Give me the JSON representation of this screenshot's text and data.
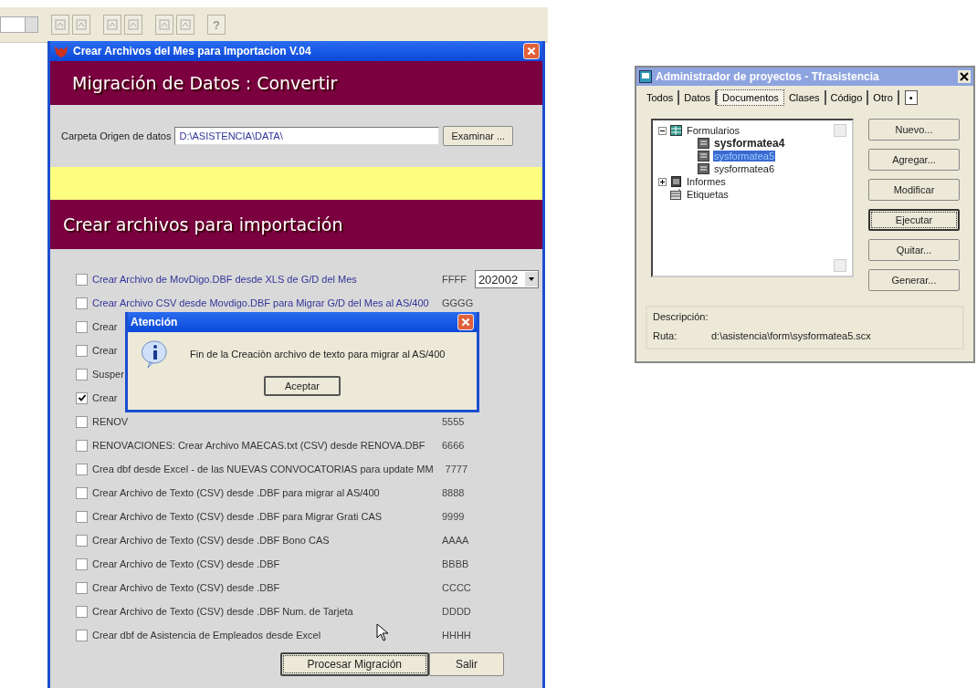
{
  "toolbar": {
    "help_label": "?"
  },
  "main_window": {
    "title": "Crear Archivos del Mes para Importacion  V.04",
    "header": "Migración de Datos : Convertir",
    "folder_label": "Carpeta Origen de datos",
    "folder_value": "D:\\ASISTENCIA\\DATA\\",
    "browse_button": "Examinar ...",
    "section_title": "Crear archivos para importación",
    "options": [
      {
        "label": "Crear Archivo de  MovDigo.DBF desde XLS de G/D  del Mes",
        "code": "FFFF",
        "checked": false,
        "color": "#33339a",
        "dropdown": "202002"
      },
      {
        "label": "Crear Archivo CSV desde  Movdigo.DBF para Migrar G/D del Mes al AS/400",
        "code": "GGGG",
        "checked": false,
        "color": "#33339a"
      },
      {
        "label": "Crear",
        "checked": false,
        "color": "#333333"
      },
      {
        "label": "Crear",
        "checked": false,
        "color": "#333333"
      },
      {
        "label": "Susper",
        "checked": false,
        "color": "#333333"
      },
      {
        "label": "Crear",
        "checked": true,
        "color": "#333333"
      },
      {
        "label": "RENOV",
        "code": "5555",
        "checked": false,
        "color": "#333333"
      },
      {
        "label": "RENOVACIONES: Crear Archivo MAECAS.txt (CSV) desde  RENOVA.DBF",
        "code": "6666",
        "checked": false,
        "color": "#333333"
      },
      {
        "label": "Crea dbf desde Excel - de las NUEVAS CONVOCATORIAS para update MM",
        "code": "7777",
        "checked": false,
        "color": "#333333"
      },
      {
        "label": "Crear Archivo de Texto (CSV) desde  .DBF  para migrar al AS/400",
        "code": "8888",
        "checked": false,
        "color": "#333333"
      },
      {
        "label": "Crear Archivo de Texto (CSV) desde  .DBF  para Migrar Grati CAS",
        "code": "9999",
        "checked": false,
        "color": "#333333"
      },
      {
        "label": "Crear Archivo de Texto (CSV) desde  .DBF  Bono CAS",
        "code": "AAAA",
        "checked": false,
        "color": "#333333"
      },
      {
        "label": "Crear Archivo de Texto (CSV) desde  .DBF",
        "code": "BBBB",
        "checked": false,
        "color": "#333333"
      },
      {
        "label": "Crear Archivo de Texto (CSV) desde  .DBF",
        "code": "CCCC",
        "checked": false,
        "color": "#333333"
      },
      {
        "label": "Crear Archivo de Texto (CSV) desde  .DBF Num. de Tarjeta",
        "code": "DDDD",
        "checked": false,
        "color": "#333333"
      },
      {
        "label": "Crear  dbf de Asistencia  de Empleados desde  Excel",
        "code": "HHHH",
        "checked": false,
        "color": "#333333"
      }
    ],
    "buttons": [
      {
        "label": "Procesar Migración",
        "focused": true
      },
      {
        "label": "Salir",
        "focused": false
      }
    ]
  },
  "dialog": {
    "title": "Atención",
    "message": "Fin de la Creaciòn archivo de texto para migrar al AS/400",
    "button": "Aceptar"
  },
  "project_manager": {
    "title": "Administrador de proyectos - Tfrasistencia",
    "tabs": [
      {
        "label": "Todos",
        "selected": false
      },
      {
        "label": "Datos",
        "selected": false
      },
      {
        "label": "Documentos",
        "selected": true
      },
      {
        "label": "Clases",
        "selected": false
      },
      {
        "label": "Código",
        "selected": false
      },
      {
        "label": "Otro",
        "selected": false
      }
    ],
    "tab_more": "•",
    "tree": [
      {
        "label": "Formularios",
        "expanded": true,
        "kind": "forms",
        "children": [
          {
            "label": "sysformatea4",
            "bold": true,
            "selected": false,
            "kind": "form"
          },
          {
            "label": "sysformatea5",
            "bold": false,
            "selected": true,
            "kind": "form"
          },
          {
            "label": "sysformatea6",
            "bold": false,
            "selected": false,
            "kind": "form"
          }
        ]
      },
      {
        "label": "Informes",
        "expanded": false,
        "kind": "reports"
      },
      {
        "label": "Etiquetas",
        "kind": "labels"
      }
    ],
    "buttons": [
      {
        "label": "Nuevo...",
        "default": false
      },
      {
        "label": "Agregar...",
        "default": false
      },
      {
        "label": "Modificar",
        "default": false
      },
      {
        "label": "Ejecutar",
        "default": true
      },
      {
        "label": "Quitar...",
        "default": false
      },
      {
        "label": "Generar...",
        "default": false
      }
    ],
    "description_label": "Descripción:",
    "path_label": "Ruta:",
    "path_value": "d:\\asistencia\\form\\sysformatea5.scx"
  }
}
